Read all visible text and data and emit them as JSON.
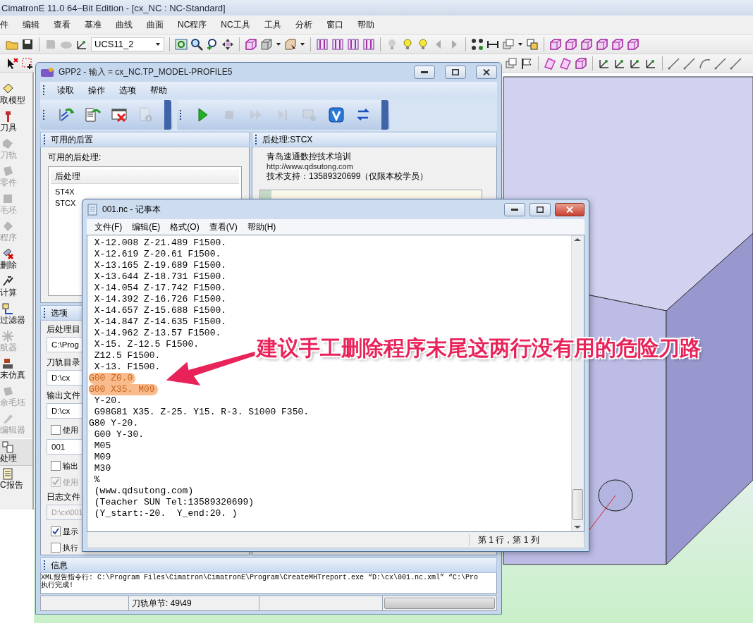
{
  "app": {
    "title": "CimatronE 11.0 64–Bit Edition - [cx_NC : NC-Standard]",
    "menu": [
      "件",
      "编辑",
      "查看",
      "基准",
      "曲线",
      "曲面",
      "NC程序",
      "NC工具",
      "工具",
      "分析",
      "窗口",
      "帮助"
    ],
    "ucs_combo": {
      "value": "UCS11_2"
    }
  },
  "sidebar": {
    "items": [
      {
        "label": "取模型",
        "disabled": false,
        "selected": false
      },
      {
        "label": "刀具",
        "disabled": false,
        "selected": false
      },
      {
        "label": "刀轨",
        "disabled": true,
        "selected": false
      },
      {
        "label": "零件",
        "disabled": true,
        "selected": false
      },
      {
        "label": "毛坯",
        "disabled": true,
        "selected": false
      },
      {
        "label": "程序",
        "disabled": true,
        "selected": false
      },
      {
        "label": "删除",
        "disabled": false,
        "selected": false
      },
      {
        "label": "计算",
        "disabled": false,
        "selected": false
      },
      {
        "label": "过滤器",
        "disabled": false,
        "selected": false
      },
      {
        "label": "航器",
        "disabled": true,
        "selected": false
      },
      {
        "label": "末仿真",
        "disabled": false,
        "selected": false
      },
      {
        "label": "余毛坯",
        "disabled": true,
        "selected": false
      },
      {
        "label": "编辑器",
        "disabled": true,
        "selected": false
      },
      {
        "label": "处理",
        "disabled": false,
        "selected": true
      },
      {
        "label": "C报告",
        "disabled": false,
        "selected": false
      }
    ]
  },
  "gpp_window": {
    "title": "GPP2 - 输入 = cx_NC.TP_MODEL-PROFILE5",
    "menu": [
      "读取",
      "操作",
      "选项",
      "帮助"
    ],
    "tools": [
      {
        "kind": "import",
        "disabled": false
      },
      {
        "kind": "document",
        "disabled": false
      },
      {
        "kind": "delete",
        "disabled": false
      },
      {
        "kind": "info",
        "disabled": true
      },
      {
        "kind": "run",
        "disabled": false
      },
      {
        "kind": "stop",
        "disabled": true
      },
      {
        "kind": "fast-forward",
        "disabled": true
      },
      {
        "kind": "step",
        "disabled": true
      },
      {
        "kind": "simulate",
        "disabled": true
      },
      {
        "kind": "verify",
        "disabled": false
      },
      {
        "kind": "swap",
        "disabled": false
      }
    ],
    "posts_panel": {
      "header": "可用的后置",
      "label": "可用的后处理:",
      "column": "后处理",
      "items": [
        {
          "label": "ST4X",
          "selected": false
        },
        {
          "label": "STCX",
          "selected": false
        }
      ]
    },
    "post_panel": {
      "header": "后处理:STCX",
      "lines": [
        "青岛速通数控技术培训",
        "http://www.qdsutong.com",
        "技术支持：13589320699（仅限本校学员）"
      ]
    },
    "options_panel": {
      "header": "选项",
      "fields": [
        {
          "kind": "label",
          "text": "后处理目",
          "disabled": false
        },
        {
          "kind": "field",
          "text": "C:\\Prog",
          "disabled": false
        },
        {
          "kind": "label",
          "text": "刀轨目录",
          "disabled": false
        },
        {
          "kind": "field",
          "text": "D:\\cx",
          "disabled": false
        },
        {
          "kind": "label",
          "text": "输出文件",
          "disabled": false
        },
        {
          "kind": "field",
          "text": "D:\\cx",
          "disabled": false
        },
        {
          "kind": "checkbox",
          "text": "使用",
          "checked": false,
          "disabled": false
        },
        {
          "kind": "field",
          "text": "001",
          "disabled": false
        },
        {
          "kind": "checkbox",
          "text": "输出",
          "checked": false,
          "disabled": false
        },
        {
          "kind": "checkbox",
          "text": "使用",
          "checked": true,
          "disabled": true
        },
        {
          "kind": "label",
          "text": "日志文件",
          "disabled": false
        },
        {
          "kind": "field",
          "text": "D:\\cx\\001",
          "disabled": true
        },
        {
          "kind": "checkbox",
          "text": "显示",
          "checked": true,
          "disabled": false
        },
        {
          "kind": "checkbox",
          "text": "执行",
          "checked": false,
          "disabled": false
        }
      ]
    },
    "info_panel": {
      "header": "信息",
      "lines": [
        "XML报告指令行: C:\\Program Files\\Cimatron\\CimatronE\\Program\\CreateMHTreport.exe “D:\\cx\\001.nc.xml” “C:\\Pro",
        "执行完成!"
      ]
    },
    "status": {
      "text": "刀轨单节: 49\\49",
      "progress": {
        "level": 0
      }
    }
  },
  "notepad": {
    "title": "001.nc - 记事本",
    "menu": [
      "文件(F)",
      "编辑(E)",
      "格式(O)",
      "查看(V)",
      "帮助(H)"
    ],
    "lines": [
      {
        "text": " X-12.008 Z-21.489 F1500.",
        "highlighted": false
      },
      {
        "text": " X-12.619 Z-20.61 F1500.",
        "highlighted": false
      },
      {
        "text": " X-13.165 Z-19.689 F1500.",
        "highlighted": false
      },
      {
        "text": " X-13.644 Z-18.731 F1500.",
        "highlighted": false
      },
      {
        "text": " X-14.054 Z-17.742 F1500.",
        "highlighted": false
      },
      {
        "text": " X-14.392 Z-16.726 F1500.",
        "highlighted": false
      },
      {
        "text": " X-14.657 Z-15.688 F1500.",
        "highlighted": false
      },
      {
        "text": " X-14.847 Z-14.635 F1500.",
        "highlighted": false
      },
      {
        "text": " X-14.962 Z-13.57 F1500.",
        "highlighted": false
      },
      {
        "text": " X-15. Z-12.5 F1500.",
        "highlighted": false
      },
      {
        "text": " Z12.5 F1500.",
        "highlighted": false
      },
      {
        "text": " X-13. F1500.",
        "highlighted": false
      },
      {
        "text": "G00 Z0.0",
        "highlighted": true
      },
      {
        "text": "G00 X35. M09",
        "highlighted": true
      },
      {
        "text": " Y-20.",
        "highlighted": false
      },
      {
        "text": " G98G81 X35. Z-25. Y15. R-3. S1000 F350.",
        "highlighted": false
      },
      {
        "text": "G80 Y-20.",
        "highlighted": false
      },
      {
        "text": " G00 Y-30.",
        "highlighted": false
      },
      {
        "text": " M05",
        "highlighted": false
      },
      {
        "text": " M09",
        "highlighted": false
      },
      {
        "text": " M30",
        "highlighted": false
      },
      {
        "text": " %",
        "highlighted": false
      },
      {
        "text": " (www.qdsutong.com)",
        "highlighted": false
      },
      {
        "text": " (Teacher SUN Tel:13589320699)",
        "highlighted": false
      },
      {
        "text": " (Y_start:-20.  Y_end:20. )",
        "highlighted": false
      }
    ],
    "status": "第 1 行，第 1 列"
  },
  "annotation": {
    "text": "建议手工删除程序末尾这两行没有用的危险刀路"
  }
}
